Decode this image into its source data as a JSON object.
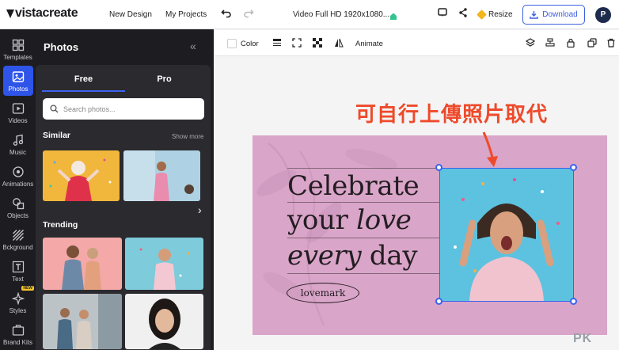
{
  "topbar": {
    "logo": "vistacreate",
    "new_design": "New Design",
    "my_projects": "My Projects",
    "doc_title": "Video Full HD 1920x1080...",
    "resize": "Resize",
    "download": "Download",
    "avatar_initial": "P"
  },
  "rail": {
    "items": [
      {
        "label": "Templates",
        "icon": "templates-icon"
      },
      {
        "label": "Photos",
        "icon": "photos-icon"
      },
      {
        "label": "Videos",
        "icon": "videos-icon"
      },
      {
        "label": "Music",
        "icon": "music-icon"
      },
      {
        "label": "Animations",
        "icon": "animations-icon"
      },
      {
        "label": "Objects",
        "icon": "objects-icon"
      },
      {
        "label": "Bckground",
        "icon": "background-icon"
      },
      {
        "label": "Text",
        "icon": "text-icon"
      },
      {
        "label": "Styles",
        "icon": "styles-icon",
        "badge": "NEW"
      },
      {
        "label": "Brand Kits",
        "icon": "brand-kits-icon"
      }
    ]
  },
  "panel": {
    "title": "Photos",
    "tabs": [
      "Free",
      "Pro"
    ],
    "search_placeholder": "Search photos...",
    "similar_title": "Similar",
    "show_more": "Show more",
    "trending_title": "Trending"
  },
  "canvas_toolbar": {
    "color": "Color",
    "animate": "Animate"
  },
  "design": {
    "line1": "Celebrate",
    "line2a": "your ",
    "line2b": "love",
    "line3a": "every",
    "line3b": " day",
    "badge": "lovemark"
  },
  "annotation": "可自行上傳照片取代",
  "watermark": "PK",
  "colors": {
    "accent": "#2f54e8",
    "card_bg": "#d9a5c8",
    "annotation": "#ee4a2a"
  }
}
